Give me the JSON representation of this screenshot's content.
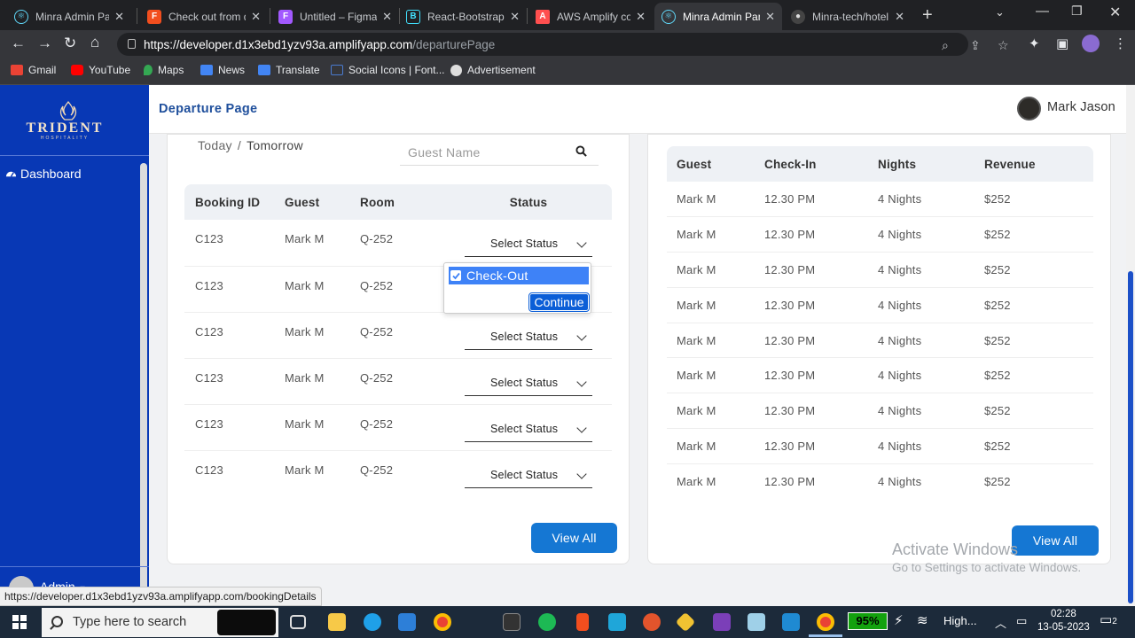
{
  "browser": {
    "tabs": [
      {
        "title": "Minra Admin Pan",
        "icon": "react-icon",
        "color": "#61dafb",
        "active": false
      },
      {
        "title": "Check out from d",
        "icon": "figma-icon",
        "color": "#f24e1e",
        "active": false
      },
      {
        "title": "Untitled – Figma",
        "icon": "figma-icon",
        "color": "#a259ff",
        "active": false
      },
      {
        "title": "React-Bootstrap",
        "icon": "bootstrap-icon",
        "color": "#41e0fd",
        "active": false
      },
      {
        "title": "AWS Amplify con",
        "icon": "aws-amplify-icon",
        "color": "#ff4f4f",
        "active": false
      },
      {
        "title": "Minra Admin Pan",
        "icon": "react-icon",
        "color": "#61dafb",
        "active": true
      },
      {
        "title": "Minra-tech/hotel",
        "icon": "github-icon",
        "color": "#888888",
        "active": false
      }
    ],
    "url_host": "https://developer.d1x3ebd1yzv93a.amplifyapp.com",
    "url_path": "/departurePage",
    "bookmarks": [
      {
        "label": "Gmail",
        "icon": "gmail-icon",
        "color": "#ea4335"
      },
      {
        "label": "YouTube",
        "icon": "youtube-icon",
        "color": "#ff0000"
      },
      {
        "label": "Maps",
        "icon": "maps-icon",
        "color": "#34a853"
      },
      {
        "label": "News",
        "icon": "news-icon",
        "color": "#4285f4"
      },
      {
        "label": "Translate",
        "icon": "translate-icon",
        "color": "#4285f4"
      },
      {
        "label": "Social Icons | Font...",
        "icon": "bookmark-flag-icon",
        "color": "#4a7bd0"
      },
      {
        "label": "Advertisement",
        "icon": "advertisement-icon",
        "color": "#dddddd"
      }
    ],
    "status_url": "https://developer.d1x3ebd1yzv93a.amplifyapp.com/bookingDetails"
  },
  "sidebar": {
    "brand": "TRIDENT",
    "brand_sub": "HOSPITALITY",
    "items": [
      {
        "label": "Dashboard",
        "icon": "dashboard-icon"
      }
    ],
    "user_label": "Admin"
  },
  "header": {
    "title": "Departure Page",
    "user_name": "Mark Jason"
  },
  "left_card": {
    "day_tabs": [
      "Today",
      "Tomorrow"
    ],
    "separator": "/",
    "search_placeholder": "Guest Name",
    "columns": [
      "Booking ID",
      "Guest",
      "Room",
      "Status"
    ],
    "rows": [
      {
        "booking_id": "C123",
        "guest": "Mark M",
        "room": "Q-252",
        "status": "Select Status"
      },
      {
        "booking_id": "C123",
        "guest": "Mark M",
        "room": "Q-252",
        "status": ""
      },
      {
        "booking_id": "C123",
        "guest": "Mark M",
        "room": "Q-252",
        "status": "Select Status"
      },
      {
        "booking_id": "C123",
        "guest": "Mark M",
        "room": "Q-252",
        "status": "Select Status"
      },
      {
        "booking_id": "C123",
        "guest": "Mark M",
        "room": "Q-252",
        "status": "Select Status"
      },
      {
        "booking_id": "C123",
        "guest": "Mark M",
        "room": "Q-252",
        "status": "Select Status"
      }
    ],
    "dropdown": {
      "option": "Check-Out",
      "checked": true,
      "button": "Continue"
    },
    "view_all": "View All"
  },
  "right_card": {
    "columns": [
      "Guest",
      "Check-In",
      "Nights",
      "Revenue"
    ],
    "rows": [
      {
        "guest": "Mark M",
        "checkin": "12.30 PM",
        "nights": "4 Nights",
        "revenue": "$252"
      },
      {
        "guest": "Mark M",
        "checkin": "12.30 PM",
        "nights": "4 Nights",
        "revenue": "$252"
      },
      {
        "guest": "Mark M",
        "checkin": "12.30 PM",
        "nights": "4 Nights",
        "revenue": "$252"
      },
      {
        "guest": "Mark M",
        "checkin": "12.30 PM",
        "nights": "4 Nights",
        "revenue": "$252"
      },
      {
        "guest": "Mark M",
        "checkin": "12.30 PM",
        "nights": "4 Nights",
        "revenue": "$252"
      },
      {
        "guest": "Mark M",
        "checkin": "12.30 PM",
        "nights": "4 Nights",
        "revenue": "$252"
      },
      {
        "guest": "Mark M",
        "checkin": "12.30 PM",
        "nights": "4 Nights",
        "revenue": "$252"
      },
      {
        "guest": "Mark M",
        "checkin": "12.30 PM",
        "nights": "4 Nights",
        "revenue": "$252"
      },
      {
        "guest": "Mark M",
        "checkin": "12.30 PM",
        "nights": "4 Nights",
        "revenue": "$252"
      }
    ],
    "view_all": "View All"
  },
  "watermark": {
    "line1": "Activate Windows",
    "line2": "Go to Settings to activate Windows."
  },
  "taskbar": {
    "search_placeholder": "Type here to search",
    "battery": "95%",
    "network": "High...",
    "time": "02:28",
    "date": "13-05-2023",
    "notifications": "2",
    "pinned": [
      {
        "icon": "task-view-icon",
        "color": "#dddddd"
      },
      {
        "icon": "file-explorer-icon",
        "color": "#f7c948"
      },
      {
        "icon": "edge-icon",
        "color": "#1fa0e8"
      },
      {
        "icon": "store-icon",
        "color": "#2d7fd8"
      },
      {
        "icon": "chrome-icon",
        "color": "#e94235"
      },
      {
        "icon": "terminal-icon",
        "color": "#333333"
      },
      {
        "icon": "spotify-icon",
        "color": "#1db954"
      },
      {
        "icon": "figma-icon",
        "color": "#f24e1e"
      },
      {
        "icon": "prime-video-icon",
        "color": "#1fa6d9"
      },
      {
        "icon": "app-badge-icon",
        "color": "#e3542c"
      },
      {
        "icon": "dev-tool-icon",
        "color": "#f1c232"
      },
      {
        "icon": "onenote-icon",
        "color": "#7b3fb8"
      },
      {
        "icon": "notes-icon",
        "color": "#9fd0e8"
      },
      {
        "icon": "vscode-icon",
        "color": "#1f8ad2"
      },
      {
        "icon": "chrome-active-icon",
        "color": "#e94235"
      }
    ]
  }
}
